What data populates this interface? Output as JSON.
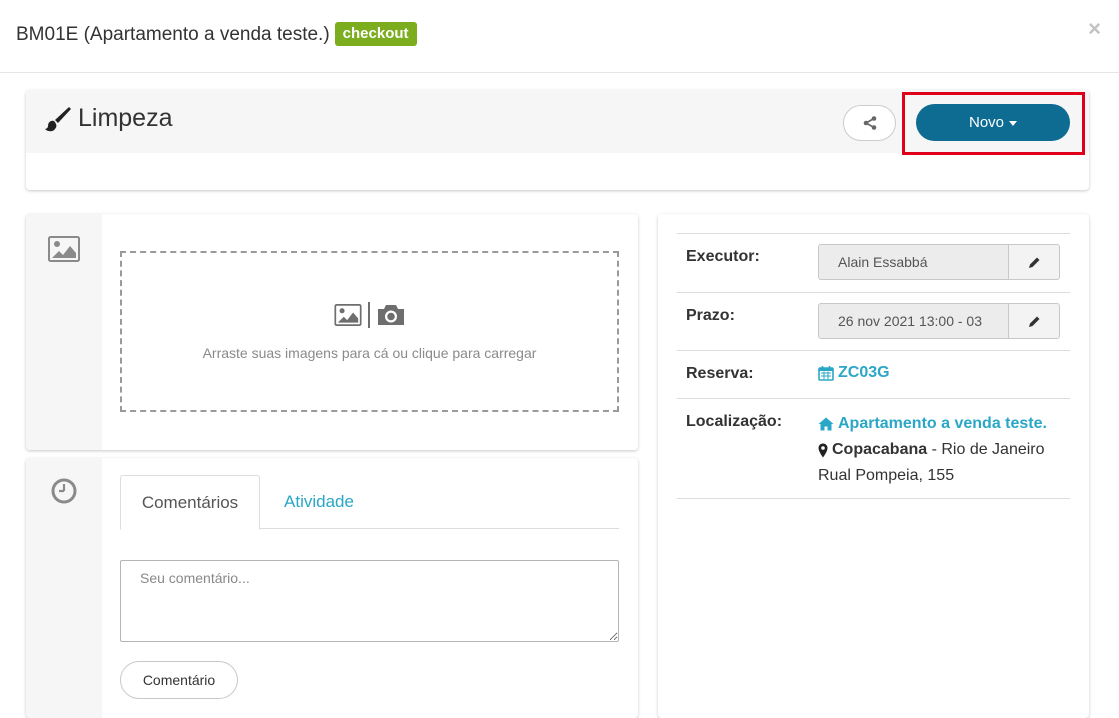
{
  "modal": {
    "title": "BM01E (Apartamento a venda teste.)",
    "badge": "checkout",
    "close_label": "×"
  },
  "header": {
    "title": "Limpeza",
    "novo_label": "Novo"
  },
  "images": {
    "dropzone_text": "Arraste suas imagens para cá ou clique para carregar"
  },
  "activity": {
    "tabs": [
      {
        "label": "Comentários"
      },
      {
        "label": "Atividade"
      }
    ],
    "comment_placeholder": "Seu comentário...",
    "comment_button": "Comentário"
  },
  "details": {
    "executor_label": "Executor:",
    "executor_value": "Alain Essabbá",
    "prazo_label": "Prazo:",
    "prazo_value": "26 nov 2021 13:00 - 03",
    "reserva_label": "Reserva:",
    "reserva_value": "ZC03G",
    "localizacao_label": "Localização:",
    "property_name": "Apartamento a venda teste.",
    "neighborhood": "Copacabana",
    "city": " - Rio de Janeiro",
    "address": "Rual Pompeia, 155"
  },
  "colors": {
    "badge": "#7cad1f",
    "primary_button": "#0e6c93",
    "link": "#2aa7c6",
    "highlight": "#e0001a"
  },
  "icons": [
    "brush-icon",
    "share-icon",
    "image-icon",
    "camera-icon",
    "clock-icon",
    "pencil-icon",
    "calendar-icon",
    "home-icon",
    "map-marker-icon",
    "close-icon"
  ]
}
